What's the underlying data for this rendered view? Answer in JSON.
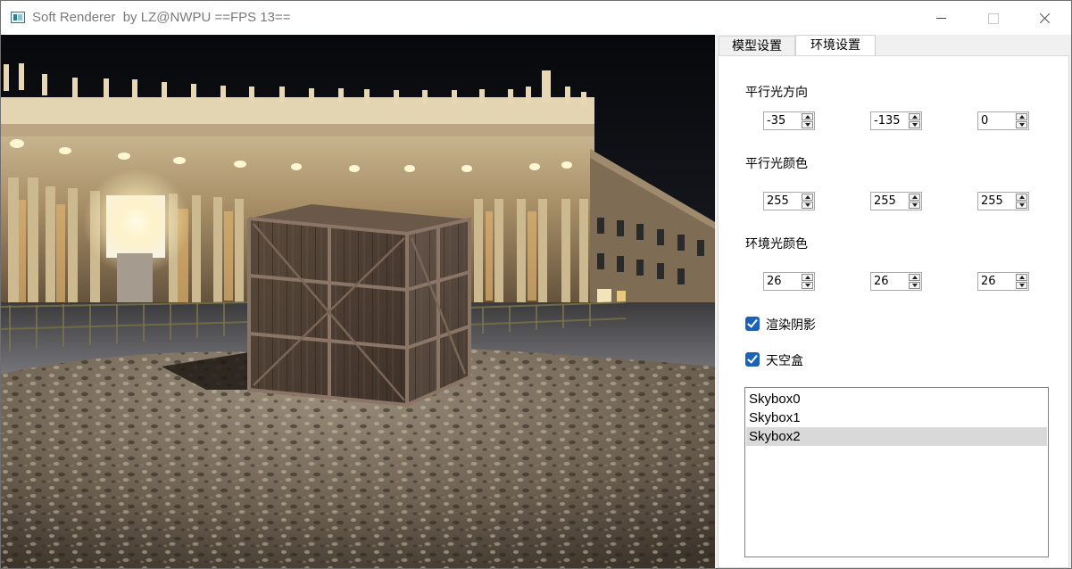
{
  "window": {
    "title": "Soft Renderer  by LZ@NWPU ==FPS 13=="
  },
  "tabs": [
    {
      "label": "模型设置",
      "active": false
    },
    {
      "label": "环境设置",
      "active": true
    }
  ],
  "light_direction": {
    "label": "平行光方向",
    "values": [
      "-35",
      "-135",
      "0"
    ]
  },
  "light_color": {
    "label": "平行光颜色",
    "values": [
      "255",
      "255",
      "255"
    ]
  },
  "ambient_color": {
    "label": "环境光颜色",
    "values": [
      "26",
      "26",
      "26"
    ]
  },
  "checkboxes": {
    "render_shadow": {
      "label": "渲染阴影",
      "checked": true
    },
    "skybox": {
      "label": "天空盒",
      "checked": true
    }
  },
  "skybox_list": {
    "items": [
      "Skybox0",
      "Skybox1",
      "Skybox2"
    ],
    "selected": "Skybox2"
  },
  "colors": {
    "accent": "#1c62b9",
    "selection": "#d9d9d9"
  }
}
